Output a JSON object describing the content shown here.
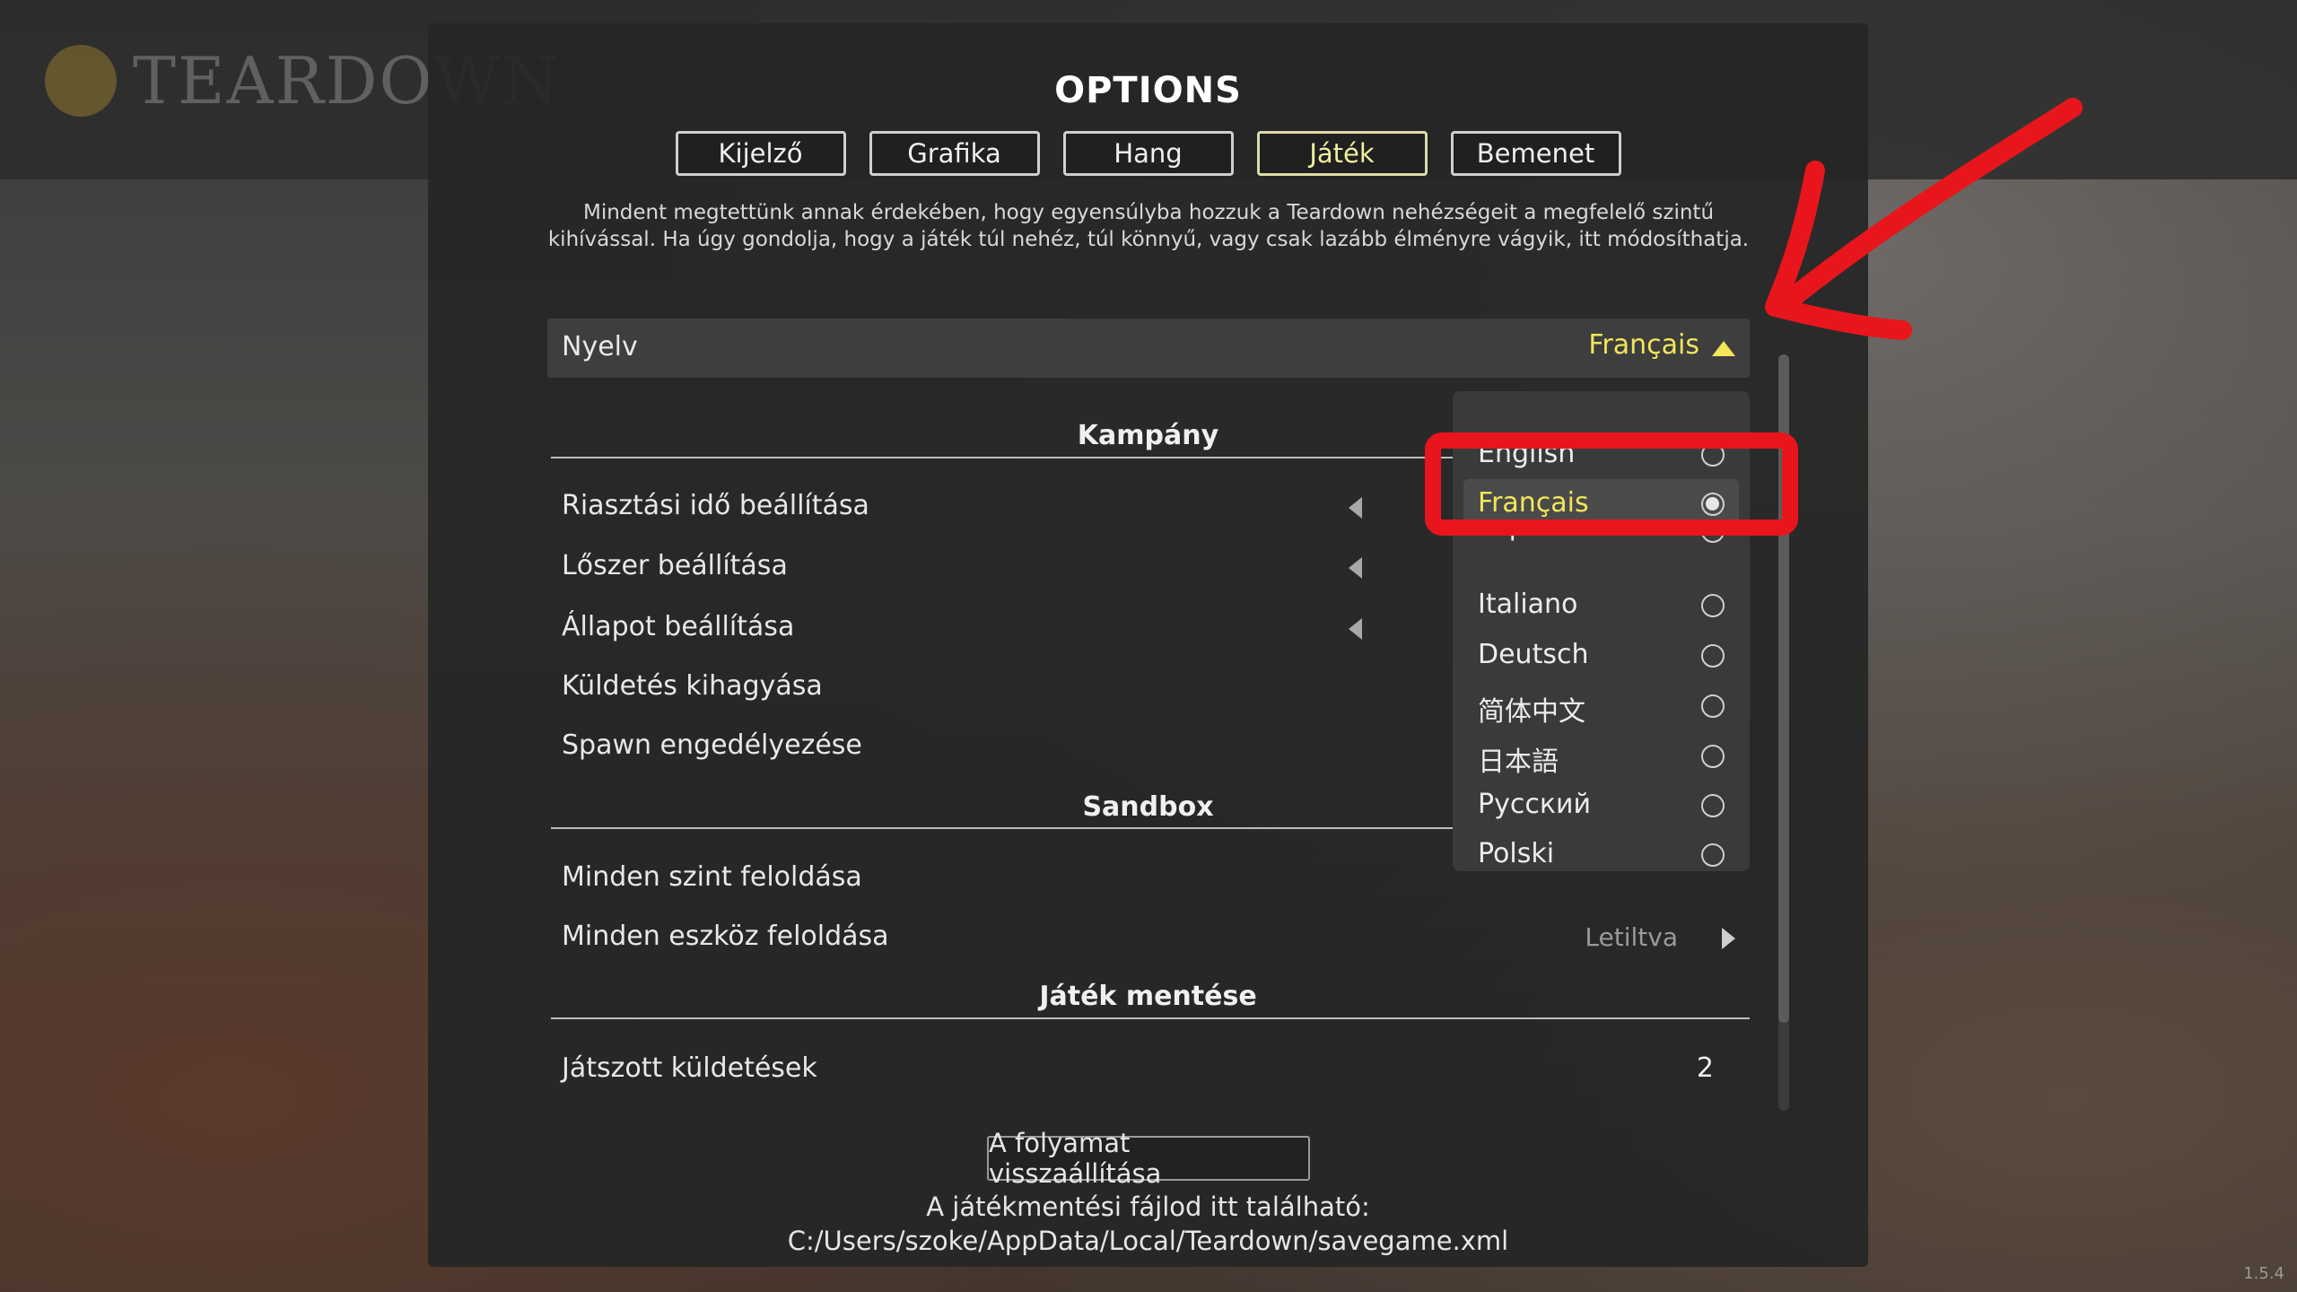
{
  "background": {
    "logo_text": "TEARDOWN"
  },
  "title": "OPTIONS",
  "tabs": [
    {
      "label": "Kijelző"
    },
    {
      "label": "Grafika"
    },
    {
      "label": "Hang"
    },
    {
      "label": "Játék",
      "active": true
    },
    {
      "label": "Bemenet"
    }
  ],
  "description": "Mindent megtettünk annak érdekében, hogy egyensúlyba hozzuk a Teardown nehézségeit a megfelelő szintű kihívással. Ha úgy gondolja, hogy a játék túl nehéz, túl könnyű, vagy csak lazább élményre vágyik, itt módosíthatja.",
  "language": {
    "label": "Nyelv",
    "value": "Français",
    "caret_icon": "caret-up-icon"
  },
  "sections": {
    "campaign": "Kampány",
    "sandbox": "Sandbox",
    "savegame": "Játék mentése"
  },
  "settings": {
    "alarm": "Riasztási idő beállítása",
    "ammo": "Lőszer beállítása",
    "health": "Állapot beállítása",
    "skip_mission": "Küldetés kihagyása",
    "spawn": "Spawn engedélyezése",
    "unlock_levels": "Minden szint feloldása",
    "unlock_tools": "Minden eszköz feloldása",
    "unlock_tools_value": "Letiltva",
    "missions_played": "Játszott küldetések",
    "missions_played_value": "2"
  },
  "language_options": [
    {
      "label": "English",
      "selected": false
    },
    {
      "label": "Français",
      "selected": true
    },
    {
      "label": "Español",
      "selected": false
    },
    {
      "label": "Italiano",
      "selected": false
    },
    {
      "label": "Deutsch",
      "selected": false
    },
    {
      "label": "简体中文",
      "selected": false
    },
    {
      "label": "日本語",
      "selected": false
    },
    {
      "label": "Русский",
      "selected": false
    },
    {
      "label": "Polski",
      "selected": false
    }
  ],
  "reset_button": "A folyamat visszaállítása",
  "save_info": {
    "line1": "A játékmentési fájlod itt található:",
    "line2": "C:/Users/szoke/AppData/Local/Teardown/savegame.xml"
  },
  "version": "1.5.4",
  "colors": {
    "accent_yellow": "#f2e65a",
    "annotation_red": "#e8161c",
    "panel_bg": "#262626"
  }
}
